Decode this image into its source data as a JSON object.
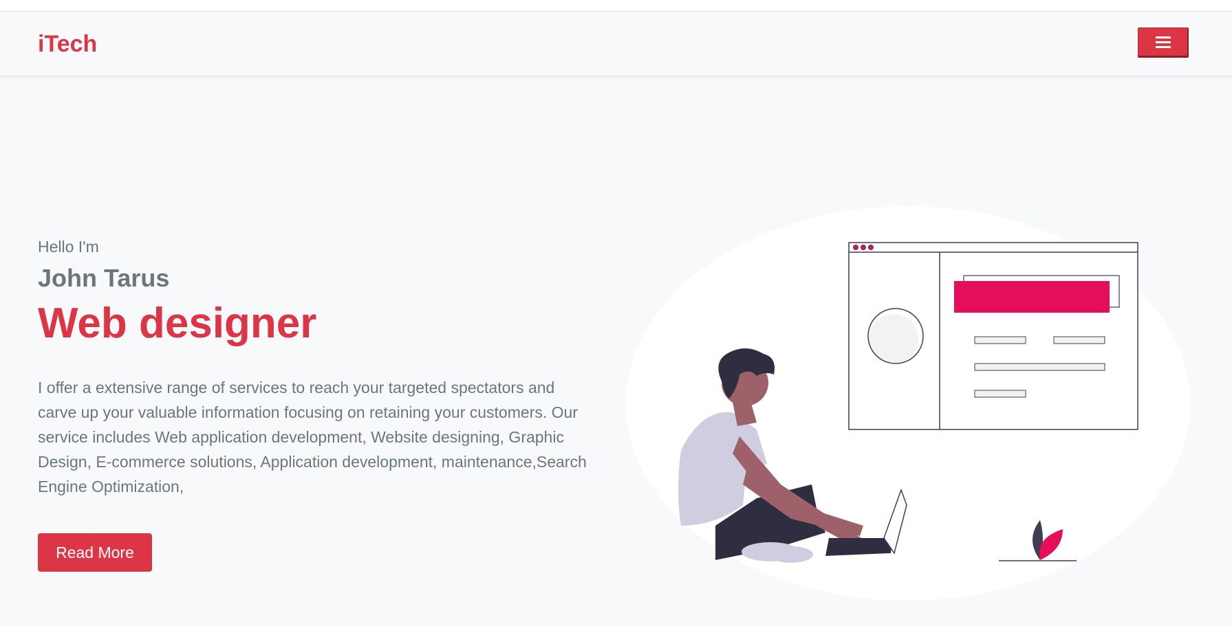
{
  "navbar": {
    "brand": "iTech",
    "menu_icon": "hamburger-menu-icon"
  },
  "hero": {
    "greeting": "Hello I'm",
    "name": "John Tarus",
    "role": "Web designer",
    "description": "I offer a extensive range of services to reach your targeted spectators and carve up your valuable information focusing on retaining your customers. Our service includes Web application development, Website designing, Graphic Design, E-commerce solutions, Application development, maintenance,Search Engine Optimization,",
    "button_label": "Read More"
  },
  "colors": {
    "accent": "#dc3545",
    "illustration_accent": "#e60d5a",
    "text_muted": "#6c757d",
    "background": "#f8f9fa"
  }
}
